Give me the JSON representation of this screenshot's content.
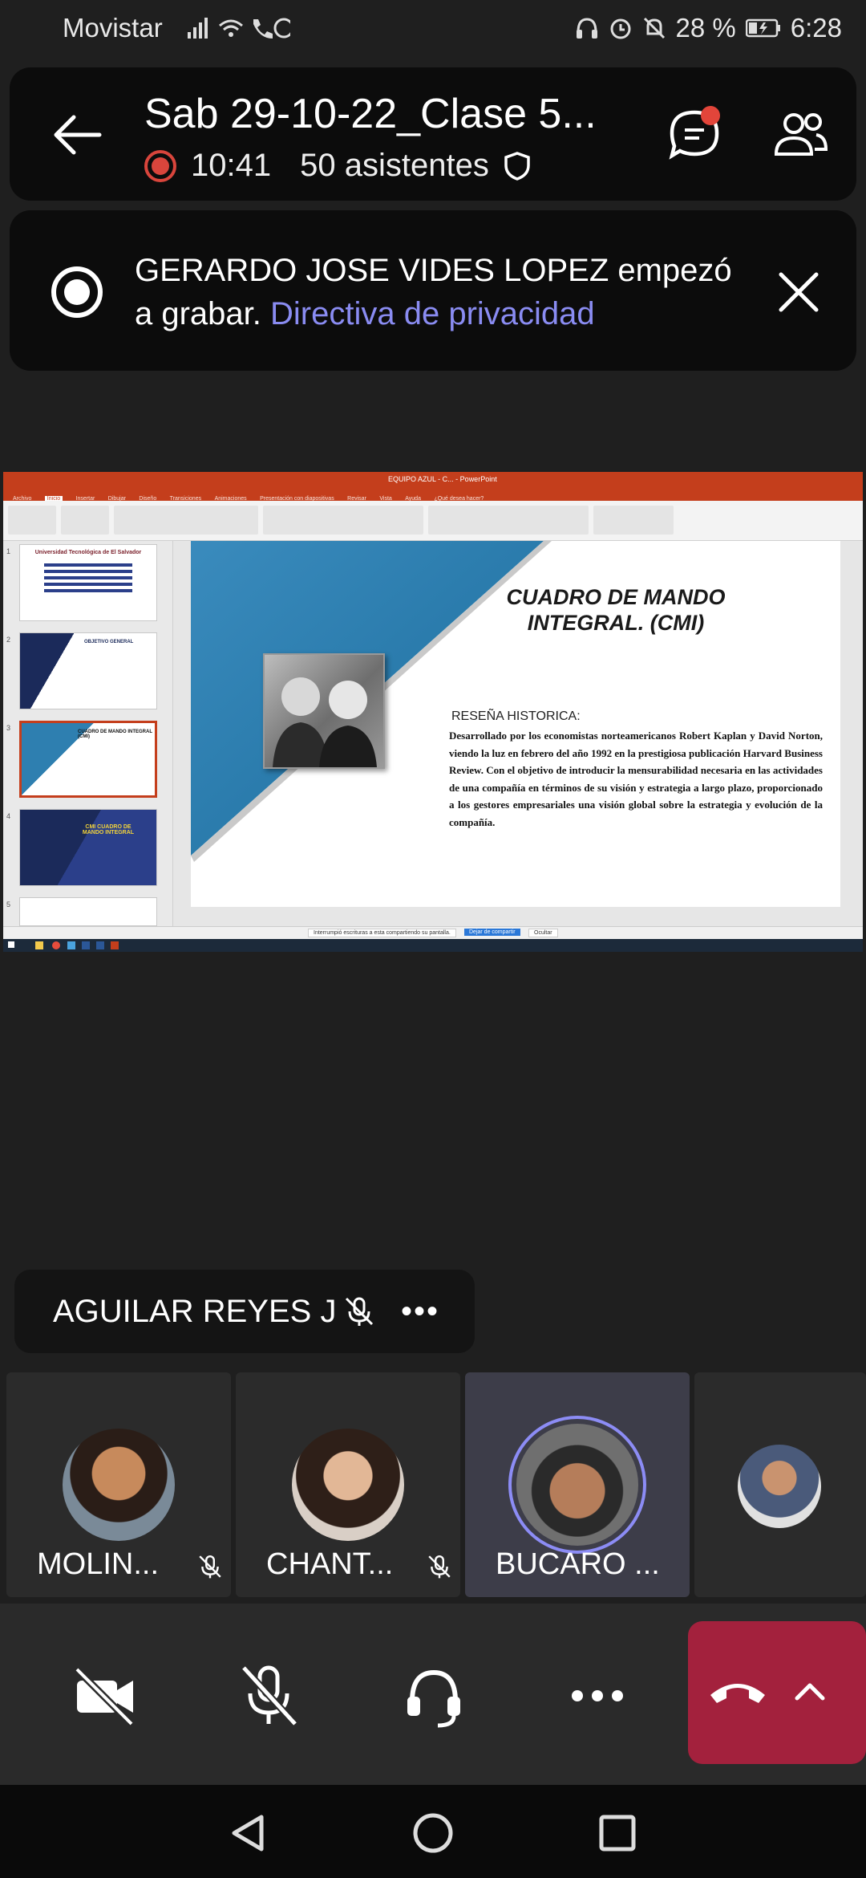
{
  "status_bar": {
    "carrier": "Movistar",
    "battery": "28 %",
    "time": "6:28"
  },
  "meeting": {
    "title": "Sab 29-10-22_Clase 5...",
    "elapsed": "10:41",
    "attendees": "50 asistentes"
  },
  "banner": {
    "message": "GERARDO JOSE VIDES LOPEZ empezó a grabar.",
    "link": "Directiva de privacidad"
  },
  "shared_screen": {
    "window_title": "EQUIPO AZUL - C... - PowerPoint",
    "tabs": [
      "Archivo",
      "Inicio",
      "Insertar",
      "Dibujar",
      "Diseño",
      "Transiciones",
      "Animaciones",
      "Presentación con diapositivas",
      "Revisar",
      "Vista",
      "Ayuda",
      "¿Qué desea hacer?"
    ],
    "slide_title": "CUADRO DE MANDO INTEGRAL. (CMI)",
    "slide_subtitle": "RESEÑA HISTORICA:",
    "slide_body": "Desarrollado por los economistas norteamericanos Robert Kaplan y David Norton, viendo la luz en febrero del año 1992 en la prestigiosa publicación Harvard Business Review. Con el objetivo de introducir la mensurabilidad necesaria en las actividades de una compañía en términos de su visión y estrategia a largo plazo, proporcionado a los gestores empresariales una visión global sobre la estrategia y evolución de la compañía.",
    "thumb_numbers": [
      "1",
      "2",
      "3",
      "4",
      "5"
    ],
    "thumb_captions": [
      "Universidad Tecnológica de El Salvador",
      "OBJETIVO GENERAL",
      "CUADRO DE MANDO INTEGRAL (CMI)",
      "CMI CUADRO DE MANDO INTEGRAL"
    ],
    "share_notice": "Interrumpió escrituras a esta compartiendo su pantalla.",
    "share_button": "Dejar de compartir",
    "share_hide": "Ocultar"
  },
  "pinned_participant": {
    "name": "AGUILAR REYES J"
  },
  "participants": [
    {
      "name": "MOLIN..."
    },
    {
      "name": "CHANT..."
    },
    {
      "name": "BUCARO ..."
    }
  ],
  "colors": {
    "accent_link": "#8a8cf2",
    "recording_red": "#d9453c",
    "hangup": "#a3213d",
    "ppt_red": "#c43e1c"
  },
  "icons": [
    "back-arrow-icon",
    "record-icon",
    "shield-icon",
    "chat-icon",
    "people-icon",
    "close-icon",
    "mic-off-icon",
    "more-icon",
    "camera-off-icon",
    "headset-icon",
    "hangup-icon",
    "chevron-up-icon",
    "nav-back-icon",
    "nav-home-icon",
    "nav-recents-icon"
  ]
}
